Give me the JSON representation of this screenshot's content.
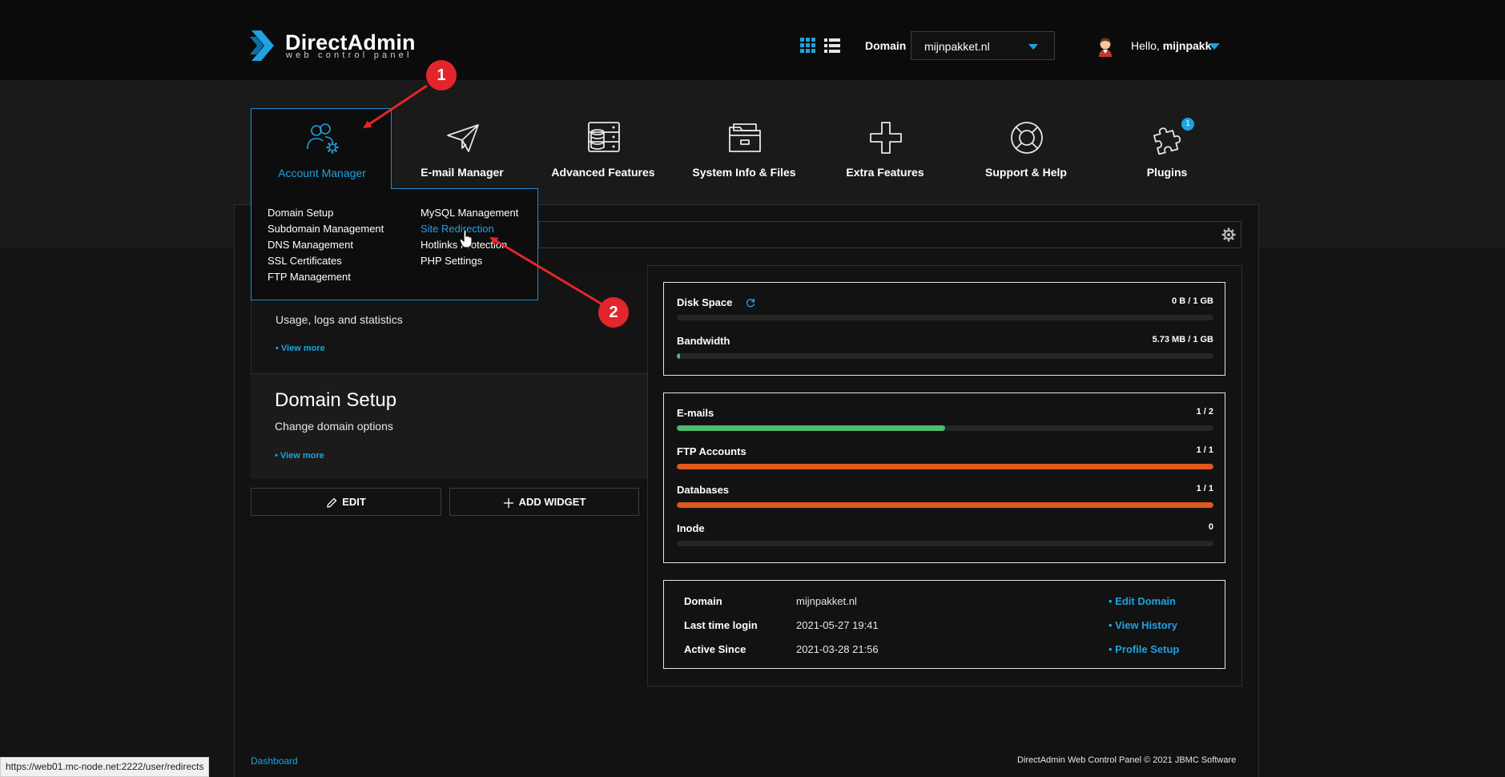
{
  "header": {
    "logo_title": "DirectAdmin",
    "logo_subtitle": "web control panel",
    "domain_label": "Domain",
    "domain_value": "mijnpakket.nl",
    "hello_prefix": "Hello,",
    "username": "mijnpakk"
  },
  "nav": {
    "items": [
      {
        "label": "Account Manager",
        "icon": "users-gear-icon"
      },
      {
        "label": "E-mail Manager",
        "icon": "paper-plane-icon"
      },
      {
        "label": "Advanced Features",
        "icon": "server-database-icon"
      },
      {
        "label": "System Info & Files",
        "icon": "folder-icon"
      },
      {
        "label": "Extra Features",
        "icon": "plus-icon"
      },
      {
        "label": "Support & Help",
        "icon": "lifebuoy-icon"
      },
      {
        "label": "Plugins",
        "icon": "puzzle-icon",
        "badge": "1"
      }
    ],
    "active_index": 0
  },
  "dropdown": {
    "col1": [
      "Domain Setup",
      "Subdomain Management",
      "DNS Management",
      "SSL Certificates",
      "FTP Management"
    ],
    "col2": [
      "MySQL Management",
      "Site Redirection",
      "Hotlinks Protection",
      "PHP Settings"
    ],
    "highlighted": "Site Redirection"
  },
  "widgets": {
    "first_desc": "Usage, logs and statistics",
    "first_more": "• View more",
    "second_title": "Domain Setup",
    "second_desc": "Change domain options",
    "second_more": "• View more"
  },
  "buttons": {
    "edit": "EDIT",
    "add_widget": "ADD WIDGET"
  },
  "usage": [
    {
      "name": "Disk Space",
      "value": "0 B / 1 GB",
      "fraction": 0.0
    },
    {
      "name": "Bandwidth",
      "value": "5.73 MB / 1 GB",
      "fraction": 0.005
    }
  ],
  "limits": [
    {
      "name": "E-mails",
      "value": "1 / 2",
      "fraction": 0.5
    },
    {
      "name": "FTP Accounts",
      "value": "1 / 1",
      "fraction": 1.0
    },
    {
      "name": "Databases",
      "value": "1 / 1",
      "fraction": 1.0
    },
    {
      "name": "Inode",
      "value": "0",
      "fraction": 0.0
    }
  ],
  "info": [
    {
      "label": "Domain",
      "value": "mijnpakket.nl",
      "link": "• Edit Domain"
    },
    {
      "label": "Last time login",
      "value": "2021-05-27 19:41",
      "link": "• View History"
    },
    {
      "label": "Active Since",
      "value": "2021-03-28 21:56",
      "link": "• Profile Setup"
    }
  ],
  "footer": {
    "breadcrumb": "Dashboard",
    "copyright": "DirectAdmin Web Control Panel © 2021 JBMC Software"
  },
  "statusbar": "https://web01.mc-node.net:2222/user/redirects",
  "annotations": {
    "badge_1": "1",
    "badge_2": "2"
  },
  "colors": {
    "accent": "#1fa2e0",
    "good": "#4cbb6c",
    "full": "#e0581c",
    "annotation": "#e2262c"
  }
}
